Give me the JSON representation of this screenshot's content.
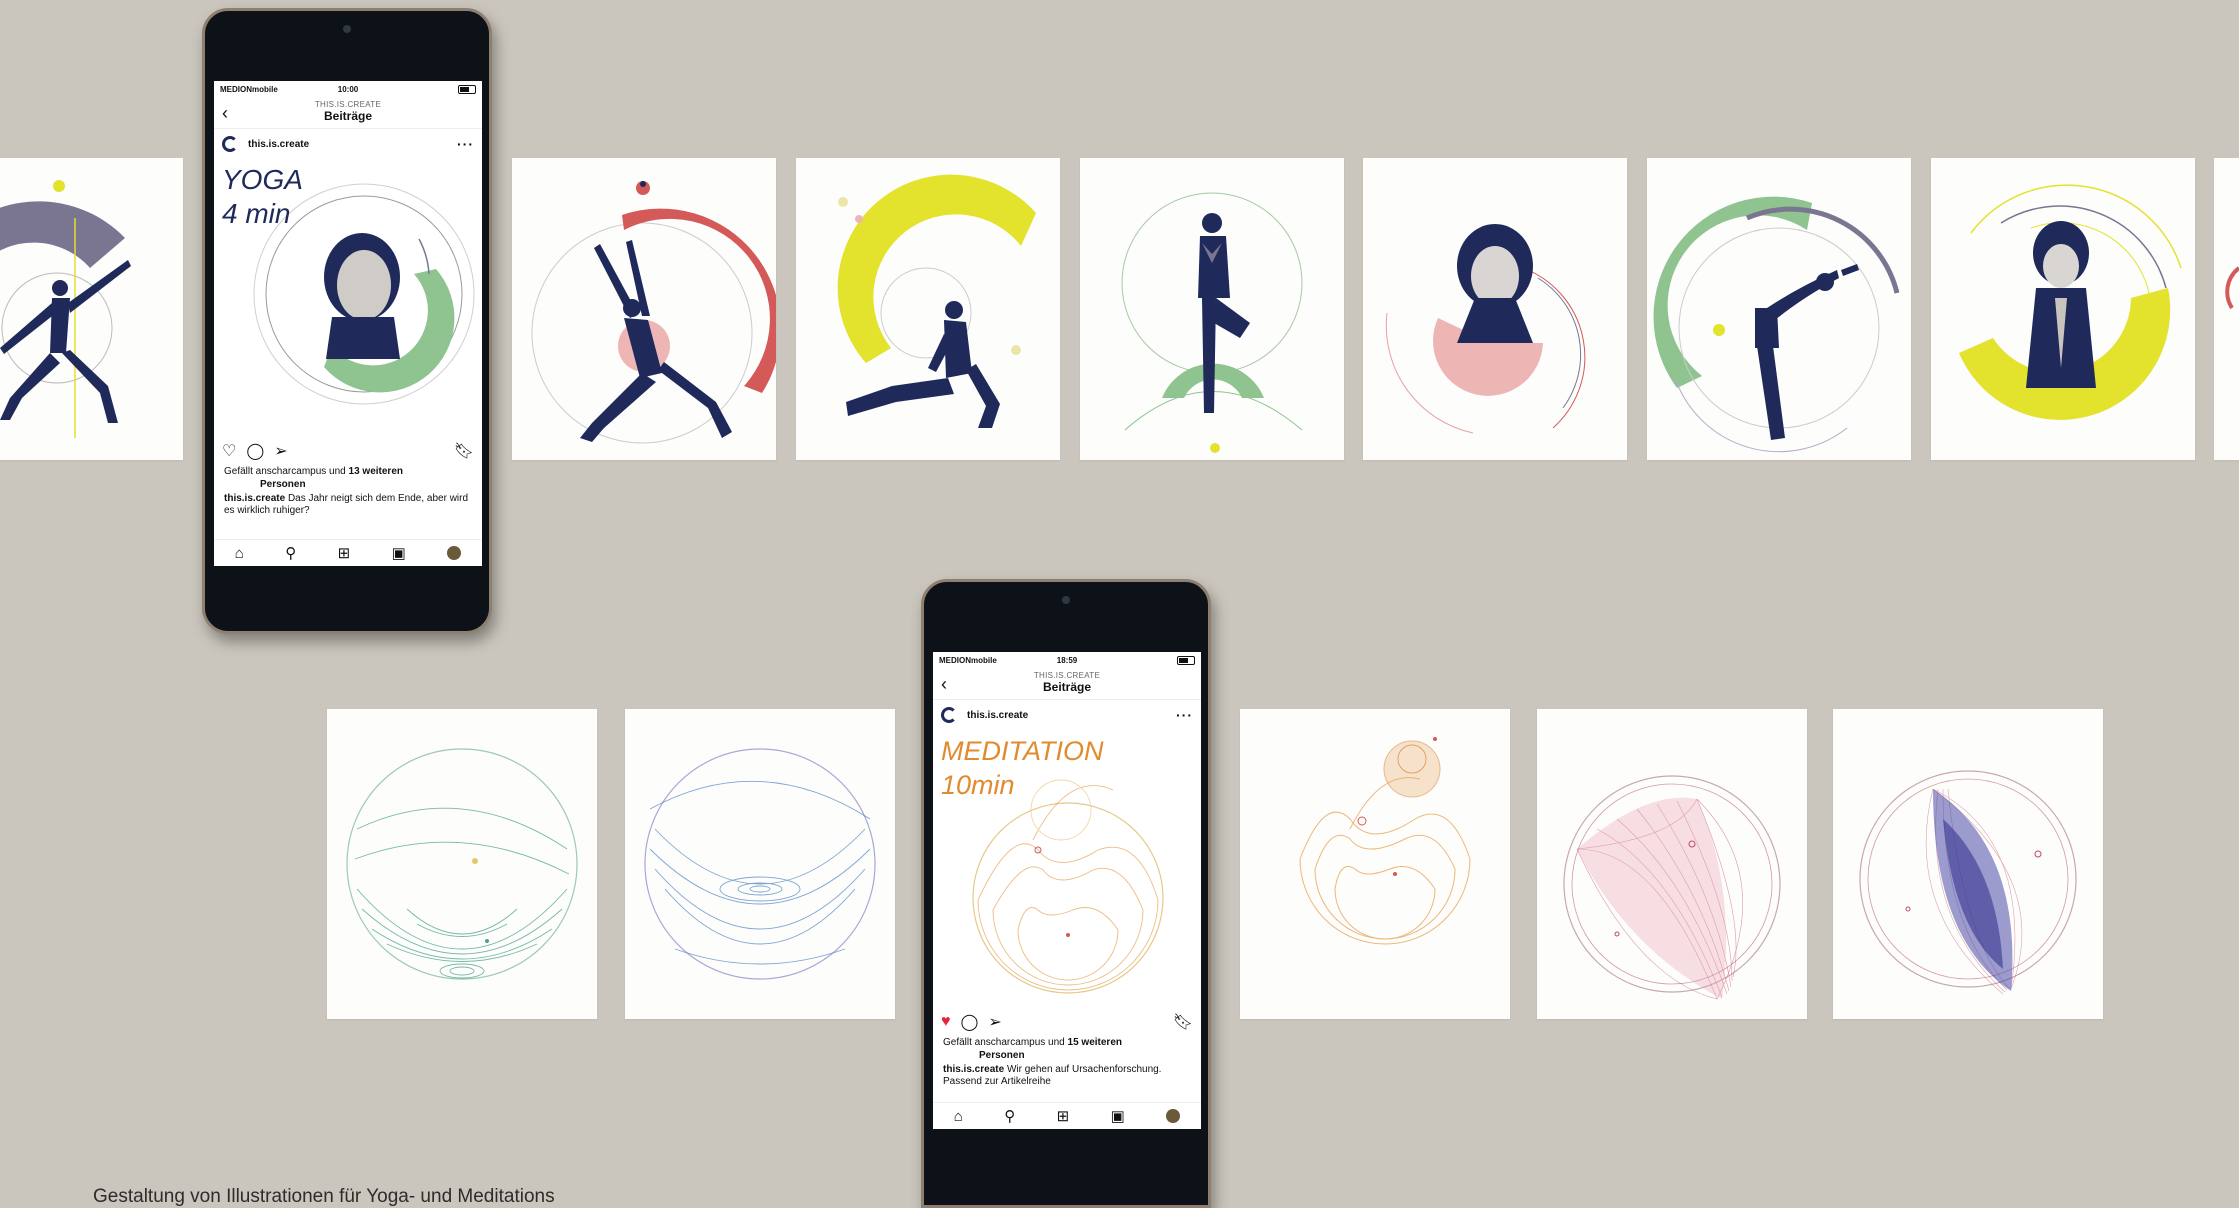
{
  "footer": {
    "caption": "Gestaltung von Illustrationen für Yoga- und Meditations"
  },
  "phone_yoga": {
    "status": {
      "carrier": "MEDIONmobile",
      "time": "10:00"
    },
    "nav": {
      "supertitle": "THIS.IS.CREATE",
      "title": "Beiträge"
    },
    "account": "this.is.create",
    "post_title": "YOGA\n4 min",
    "likes": {
      "prefix": "Gefällt anscharcampus und ",
      "count": "13 weiteren",
      "suffix": "Personen"
    },
    "caption": {
      "user": "this.is.create",
      "text": "Das Jahr neigt sich dem Ende, aber wird es wirklich ruhiger?"
    }
  },
  "phone_meditation": {
    "status": {
      "carrier": "MEDIONmobile",
      "time": "18:59"
    },
    "nav": {
      "supertitle": "THIS.IS.CREATE",
      "title": "Beiträge"
    },
    "account": "this.is.create",
    "post_title": "MEDITATION\n10min",
    "likes": {
      "prefix": "Gefällt anscharcampus und ",
      "count": "15 weiteren",
      "suffix": "Personen"
    },
    "caption": {
      "user": "this.is.create",
      "text": "Wir gehen auf Ursachenforschung. Passend zur Artikelreihe"
    }
  },
  "colors": {
    "background": "#cac6bd",
    "navy": "#1f2a5a",
    "red": "#d35a58",
    "yellow": "#e3e22c",
    "green": "#8fc490",
    "pink": "#edb5b3",
    "lavender": "#7a7591",
    "meditation_orange": "#e28a2e"
  },
  "icons": {
    "heart": "heart-icon",
    "comment": "comment-icon",
    "share": "send-icon",
    "save": "bookmark-icon",
    "home": "home-icon",
    "search": "search-icon",
    "add": "add-post-icon",
    "shop": "shop-icon"
  }
}
